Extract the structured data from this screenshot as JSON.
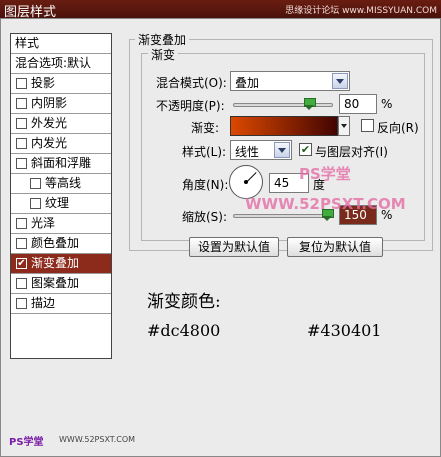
{
  "window": {
    "title": "图层样式",
    "watermark": "思缘设计论坛 www.MISSYUAN.COM"
  },
  "styles_list": {
    "header": "样式",
    "blend_default": "混合选项:默认",
    "items": [
      {
        "label": "投影",
        "checked": false,
        "sub": false,
        "selected": false
      },
      {
        "label": "内阴影",
        "checked": false,
        "sub": false,
        "selected": false
      },
      {
        "label": "外发光",
        "checked": false,
        "sub": false,
        "selected": false
      },
      {
        "label": "内发光",
        "checked": false,
        "sub": false,
        "selected": false
      },
      {
        "label": "斜面和浮雕",
        "checked": false,
        "sub": false,
        "selected": false
      },
      {
        "label": "等高线",
        "checked": false,
        "sub": true,
        "selected": false
      },
      {
        "label": "纹理",
        "checked": false,
        "sub": true,
        "selected": false
      },
      {
        "label": "光泽",
        "checked": false,
        "sub": false,
        "selected": false
      },
      {
        "label": "颜色叠加",
        "checked": false,
        "sub": false,
        "selected": false
      },
      {
        "label": "渐变叠加",
        "checked": true,
        "sub": false,
        "selected": true
      },
      {
        "label": "图案叠加",
        "checked": false,
        "sub": false,
        "selected": false
      },
      {
        "label": "描边",
        "checked": false,
        "sub": false,
        "selected": false
      }
    ]
  },
  "panel": {
    "group_title": "渐变叠加",
    "subgroup_title": "渐变",
    "blend_mode_label": "混合模式(O):",
    "blend_mode_value": "叠加",
    "opacity_label": "不透明度(P):",
    "opacity_value": "80",
    "opacity_unit": "%",
    "opacity_level": 0.8,
    "gradient_label": "渐变:",
    "reverse_label": "反向(R)",
    "reverse_checked": false,
    "style_label": "样式(L):",
    "style_value": "线性",
    "align_label": "与图层对齐(I)",
    "align_checked": true,
    "angle_label": "角度(N):",
    "angle_value": "45",
    "angle_unit": "度",
    "scale_label": "缩放(S):",
    "scale_value": "150",
    "scale_unit": "%",
    "scale_level": 1.0,
    "default_button": "设置为默认值",
    "reset_button": "复位为默认值"
  },
  "gradient_colors": {
    "title": "渐变颜色:",
    "start": "#dc4800",
    "end": "#430401"
  },
  "watermarks": {
    "ps_school": "PS学堂",
    "site": "WWW.52PSXT.COM",
    "footer_ps": "PS学堂",
    "footer_site": "WWW.52PSXT.COM"
  },
  "colors": {
    "title_bar": "#5a160e",
    "selected_item": "#8c2a1b"
  }
}
